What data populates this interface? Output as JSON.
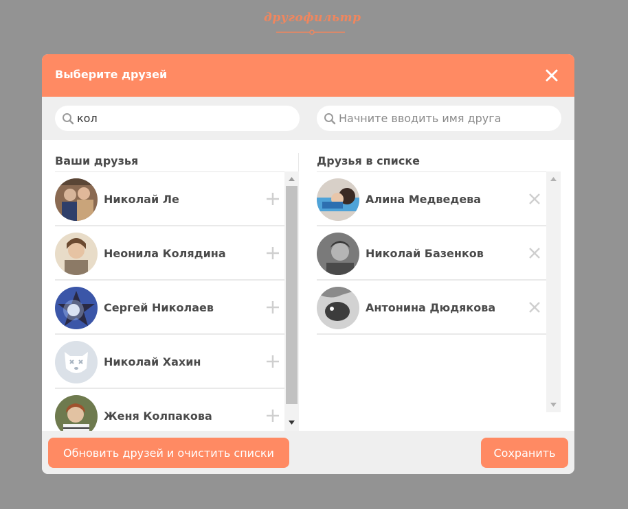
{
  "logo": {
    "text": "другофильтр"
  },
  "modal": {
    "title": "Выберите друзей",
    "left_search": {
      "value": "кол",
      "placeholder": ""
    },
    "right_search": {
      "value": "",
      "placeholder": "Начните вводить имя друга"
    },
    "left_column_title": "Ваши друзья",
    "right_column_title": "Друзья в списке",
    "your_friends": [
      {
        "name": "Николай Ле"
      },
      {
        "name": "Неонила Колядина"
      },
      {
        "name": "Сергей Николаев"
      },
      {
        "name": "Николай Хахин"
      },
      {
        "name": "Женя Колпакова"
      }
    ],
    "friends_in_list": [
      {
        "name": "Алина Медведева"
      },
      {
        "name": "Николай Базенков"
      },
      {
        "name": "Антонина Дюдякова"
      }
    ],
    "refresh_button": "Обновить друзей и очистить списки",
    "save_button": "Сохранить"
  },
  "colors": {
    "accent": "#ff8a63",
    "backdrop": "#939393",
    "panel": "#efefef"
  }
}
